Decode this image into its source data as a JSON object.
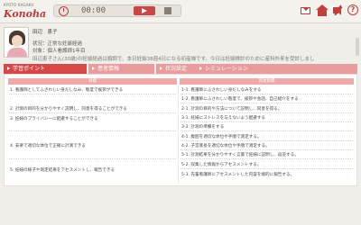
{
  "app": {
    "brand_small": "KYOTO KAGAKU",
    "brand_name": "Konoha"
  },
  "player": {
    "time": "00:00",
    "play_icon": "play-icon",
    "stop_icon": "stop-icon",
    "clock_icon": "clock-icon"
  },
  "toolbar": {
    "icons": [
      "mail-icon",
      "home-icon",
      "sound-mute-icon",
      "help-icon"
    ]
  },
  "patient": {
    "name": "田辺　恵子",
    "status_label": "状況：正常な妊娠経過",
    "target_label": "対象：個人看護師1年目",
    "description": "田辺恵子さん(30歳)の妊娠経過は順調で、本日妊娠38週4日になる初産婦です。今日は妊娠検診のために産科外来を受診しまし"
  },
  "tabs": [
    {
      "label": "学習ポイント",
      "active": true
    },
    {
      "label": "患者情報",
      "active": false
    },
    {
      "label": "状況設定",
      "active": false
    },
    {
      "label": "シミュレーション",
      "active": false
    }
  ],
  "table": {
    "left_header": "目標",
    "right_header": "到達目標",
    "left_rows": [
      "1. 看護師としてふさわしい身だしなみ、態度で挨拶ができる",
      "2. 計測の目的を分かりやすく説明し、同意を得ることができる",
      "3. 妊婦のプライバシーに配慮することができる",
      "4. 安楽で適切な体位で正確に計測できる",
      "5. 妊婦の様子や測定結果をアセスメントし、報告できる"
    ],
    "right_rows": [
      "1-1. 看護師にふさわしい身だしなみをする",
      "1-2. 看護師にふさわしい態度で、挨拶や会話、自己紹介をする",
      "2-1. 計測の目的や方法について説明し、同意を得る。",
      "3-1. 妊婦にストレスを与えないよう配慮する",
      "3-2. 計測の準備をする",
      "4-1. 腹囲を適切な体位や手順で測定する。",
      "4-2. 子宮底長を適切な体位や手順で測定する。",
      "5-1. 計測結果を分かりやすく言葉で妊婦に説明し、返答する。",
      "5-2. 収集した情報からアセスメントする。",
      "5-3. 先輩看護師にアセスメントした内容を端的に報告する。"
    ]
  },
  "colors": {
    "accent": "#d54848",
    "tab_inactive": "#e89c9c",
    "header": "#efa7a7"
  }
}
